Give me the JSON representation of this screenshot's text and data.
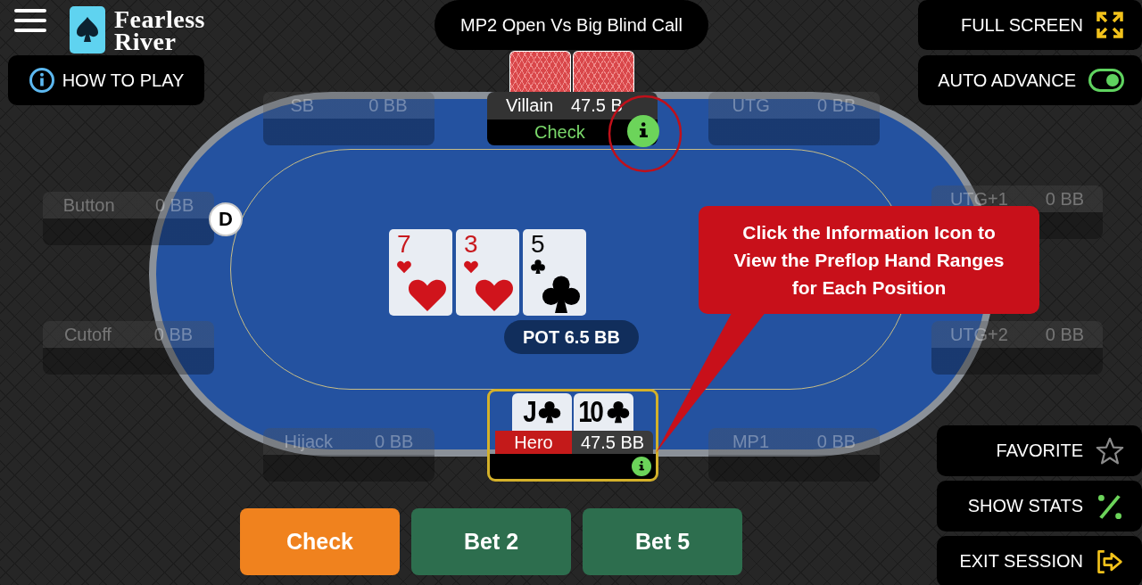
{
  "logo": {
    "lines": [
      "Fearless",
      "River"
    ]
  },
  "how_to_play": {
    "label": "HOW TO PLAY"
  },
  "scenario_title": "MP2 Open Vs Big Blind Call",
  "top_controls": [
    {
      "kind": "fullscreen",
      "label": "FULL SCREEN"
    },
    {
      "kind": "toggle",
      "label": "AUTO ADVANCE",
      "on": true
    }
  ],
  "seats": [
    {
      "position": "SB",
      "stack": "0 BB"
    },
    {
      "position": "UTG",
      "stack": "0 BB"
    },
    {
      "position": "UTG+1",
      "stack": "0 BB"
    },
    {
      "position": "Button",
      "stack": "0 BB"
    },
    {
      "position": "Cutoff",
      "stack": "0 BB"
    },
    {
      "position": "UTG+2",
      "stack": "0 BB"
    },
    {
      "position": "Hijack",
      "stack": "0 BB"
    },
    {
      "position": "MP1",
      "stack": "0 BB"
    }
  ],
  "villain": {
    "name": "Villain",
    "stack": "47.5 B",
    "action": "Check",
    "info_highlighted": true,
    "cards": [
      {
        "kind": "back"
      },
      {
        "kind": "back"
      }
    ]
  },
  "dealer_button": {
    "label": "D"
  },
  "board": [
    {
      "rank": "7",
      "kind": "hearts"
    },
    {
      "rank": "3",
      "kind": "hearts"
    },
    {
      "rank": "5",
      "kind": "clubs"
    }
  ],
  "pot": "POT 6.5 BB",
  "callout": "Click the Information Icon to View the Preflop Hand Ranges for Each Position",
  "hero": {
    "name": "Hero",
    "stack": "47.5 BB",
    "cards": [
      {
        "rank": "J",
        "kind": "clubs"
      },
      {
        "rank": "10",
        "kind": "clubs"
      }
    ]
  },
  "actions": [
    {
      "kind": "check",
      "label": "Check"
    },
    {
      "kind": "bet",
      "label": "Bet 2"
    },
    {
      "kind": "bet",
      "label": "Bet 5"
    }
  ],
  "side_controls": [
    {
      "kind": "favorite",
      "label": "FAVORITE",
      "on": false
    },
    {
      "kind": "stats",
      "label": "SHOW STATS"
    },
    {
      "kind": "exit",
      "label": "EXIT SESSION"
    }
  ]
}
